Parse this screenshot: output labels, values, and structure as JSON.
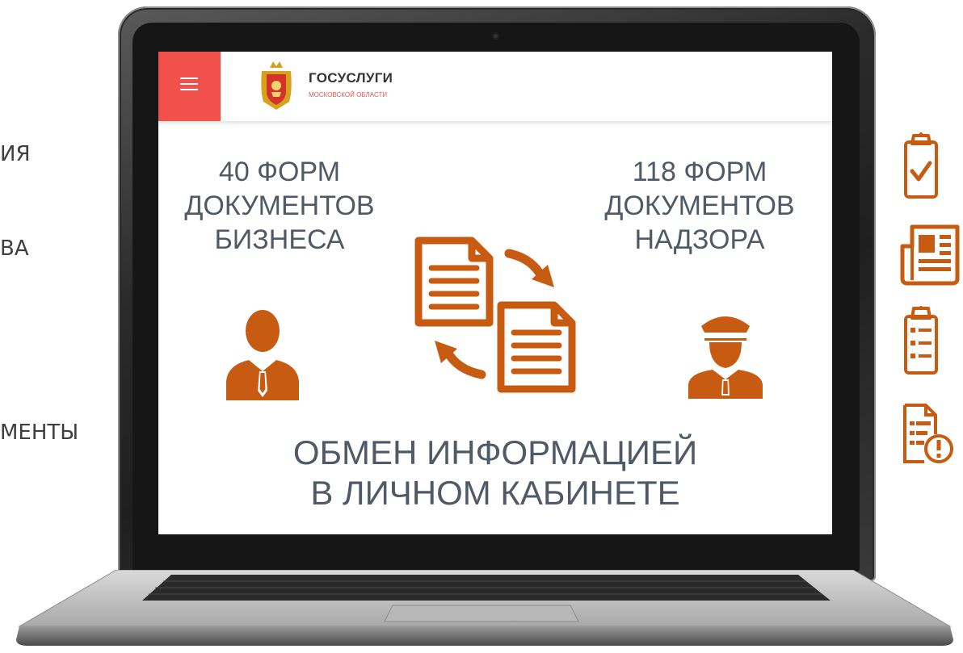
{
  "left_panel": {
    "items": [
      "ИЯ",
      "ВА",
      "МЕНТЫ"
    ]
  },
  "header": {
    "brand_title": "ГОСУСЛУГИ",
    "brand_subtitle": "МОСКОВСКОЙ ОБЛАСТИ"
  },
  "main": {
    "left_block": {
      "line1": "40 ФОРМ",
      "line2": "ДОКУМЕНТОВ",
      "line3": "БИЗНЕСА"
    },
    "right_block": {
      "line1": "118 ФОРМ",
      "line2": "ДОКУМЕНТОВ",
      "line3": "НАДЗОРА"
    },
    "bottom": {
      "line1": "ОБМЕН ИНФОРМАЦИЕЙ",
      "line2": "В ЛИЧНОМ КАБИНЕТЕ"
    }
  },
  "icons": {
    "menu": "hamburger-icon",
    "logo": "coat-of-arms-icon",
    "businessman": "businessman-icon",
    "inspector": "police-inspector-icon",
    "exchange": "document-exchange-icon",
    "right_side": [
      "clipboard-check-icon",
      "newspaper-icon",
      "clipboard-list-icon",
      "document-warning-icon"
    ]
  },
  "colors": {
    "accent_orange": "#c75b12",
    "menu_red": "#f2504b",
    "text_slate": "#4f5a66",
    "side_text": "#3f3f3f"
  }
}
